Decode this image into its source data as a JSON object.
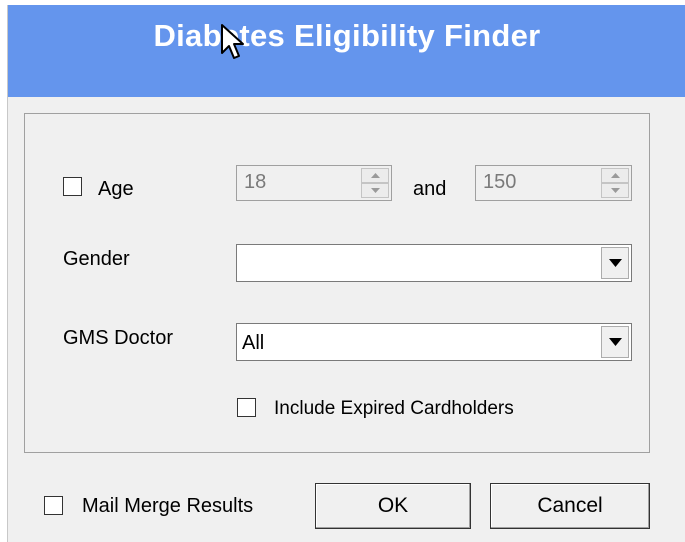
{
  "window": {
    "title": "Diabetes Eligibility Finder"
  },
  "age": {
    "checkbox_label": "Age",
    "checked": false,
    "min_value": "18",
    "separator": "and",
    "max_value": "150"
  },
  "gender": {
    "label": "Gender",
    "selected": ""
  },
  "gms_doctor": {
    "label": "GMS Doctor",
    "selected": "All"
  },
  "include_expired": {
    "label": "Include Expired Cardholders",
    "checked": false
  },
  "mail_merge": {
    "label": "Mail Merge Results",
    "checked": false
  },
  "buttons": {
    "ok": "OK",
    "cancel": "Cancel"
  },
  "icons": {
    "spin_up": "triangle-up",
    "spin_down": "triangle-down",
    "dropdown": "triangle-down",
    "cursor": "mouse-pointer-arrow"
  }
}
